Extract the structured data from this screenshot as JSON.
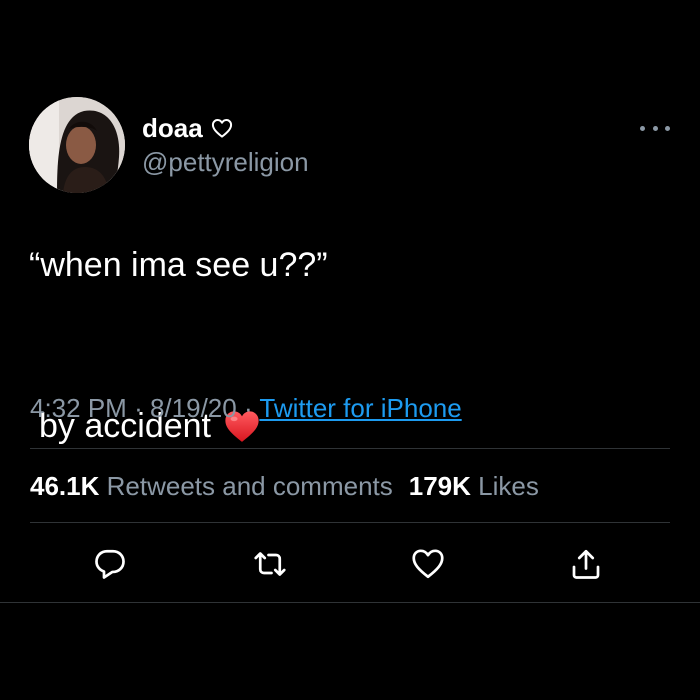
{
  "user": {
    "display_name": "doaa",
    "handle": "@pettyreligion",
    "name_badge_icon": "heart-outline-icon"
  },
  "tweet": {
    "text_line1": "“when ima see u??”",
    "text_line2": "by accident",
    "emoji_icon": "red-heart-icon",
    "time": "4:32 PM",
    "date": "8/19/20",
    "separator": "·",
    "source": "Twitter for iPhone"
  },
  "stats": {
    "retweets_count": "46.1K",
    "retweets_label": "Retweets and comments",
    "likes_count": "179K",
    "likes_label": "Likes"
  },
  "actions": {
    "reply_icon": "reply-icon",
    "retweet_icon": "retweet-icon",
    "like_icon": "heart-icon",
    "share_icon": "share-icon"
  },
  "colors": {
    "background": "#000000",
    "primary_text": "#ffffff",
    "secondary_text": "#8b98a5",
    "link": "#1d9bf0",
    "divider": "#2f3336",
    "heart_red": "#e0245e"
  }
}
